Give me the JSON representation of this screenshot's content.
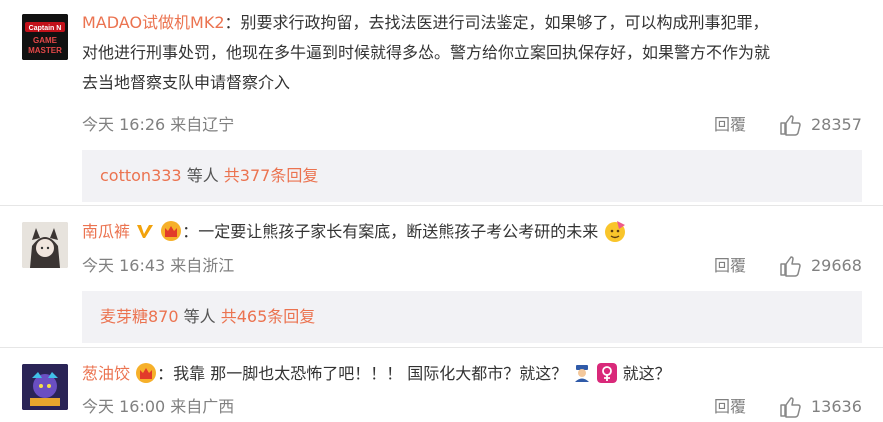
{
  "comments": [
    {
      "username": "MADAO试做机MK2",
      "text_lines": [
        "：别要求行政拘留，去找法医进行司法鉴定，如果够了，可以构成刑事犯罪，",
        "对他进行刑事处罚，他现在多牛逼到时候就得多怂。警方给你立案回执保存好，如果警方不作为就",
        "去当地督察支队申请督察介入"
      ],
      "time": "今天 16:26 来自辽宁",
      "reply_label": "回覆",
      "likes": "28357",
      "avatar_text": [
        "Captain N",
        "GAME",
        "MASTER"
      ],
      "sub": {
        "user": "cotton333",
        "deng": " 等人 ",
        "count": "共377条回复"
      }
    },
    {
      "username": "南瓜裤",
      "text": "：一定要让熊孩子家长有案底，断送熊孩子考公考研的未来",
      "time": "今天 16:43 来自浙江",
      "reply_label": "回覆",
      "likes": "29668",
      "sub": {
        "user": "麦芽糖870",
        "deng": " 等人 ",
        "count": "共465条回复"
      }
    },
    {
      "username": "葱油饺",
      "text_a": "：我靠 那一脚也太恐怖了吧！！！ 国际化大都市？就这？",
      "text_b": " 就这？",
      "time": "今天 16:00 来自广西",
      "reply_label": "回覆",
      "likes": "13636"
    }
  ],
  "icons": {
    "verified": "v-badge-icon",
    "vip": "vip-crown-icon",
    "like": "thumbs-up-icon",
    "police": "police-emoji-icon",
    "female": "female-sign-icon",
    "emoji": "party-face-emoji-icon"
  },
  "colors": {
    "username": "#eb7350",
    "meta": "#808080",
    "subbox_bg": "#f2f2f5"
  }
}
